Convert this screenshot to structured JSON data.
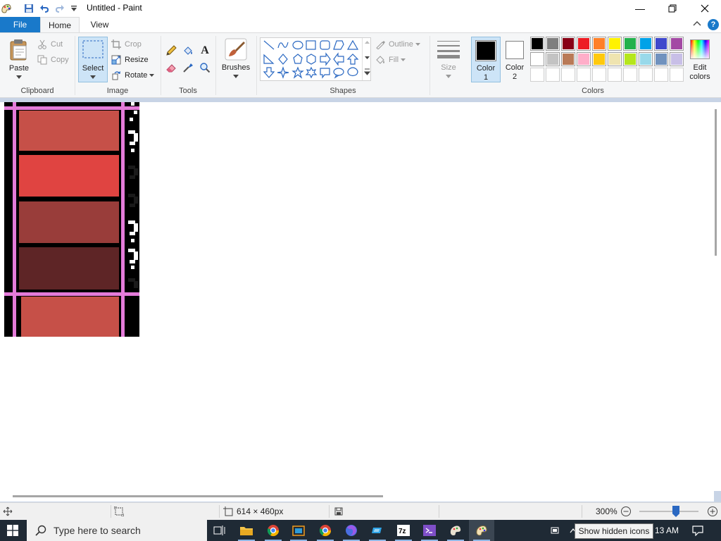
{
  "window": {
    "title": "Untitled - Paint",
    "minimize_glyph": "—",
    "restore_glyph": "❐",
    "close_glyph": "✕"
  },
  "tabs": {
    "file": "File",
    "home": "Home",
    "view": "View"
  },
  "help_glyph": "?",
  "clipboard": {
    "paste": "Paste",
    "cut": "Cut",
    "copy": "Copy",
    "label": "Clipboard"
  },
  "image": {
    "select": "Select",
    "crop": "Crop",
    "resize": "Resize",
    "rotate": "Rotate",
    "label": "Image"
  },
  "tools": {
    "label": "Tools",
    "text_glyph": "A"
  },
  "brushes": {
    "label": "Brushes"
  },
  "shapes": {
    "outline": "Outline",
    "fill": "Fill",
    "label": "Shapes"
  },
  "size": {
    "label": "Size"
  },
  "color1": {
    "label_line1": "Color",
    "label_line2": "1",
    "value": "#000000"
  },
  "color2": {
    "label_line1": "Color",
    "label_line2": "2",
    "value": "#ffffff"
  },
  "colors": {
    "label": "Colors",
    "edit_line1": "Edit",
    "edit_line2": "colors",
    "palette_row1": [
      "#000000",
      "#7f7f7f",
      "#880015",
      "#ed1c24",
      "#ff7f27",
      "#fff200",
      "#22b14c",
      "#00a2e8",
      "#3f48cc",
      "#a349a4"
    ],
    "palette_row2": [
      "#ffffff",
      "#c3c3c3",
      "#b97a57",
      "#ffaec9",
      "#ffc90e",
      "#efe4b0",
      "#b5e61d",
      "#99d9ea",
      "#7092be",
      "#c8bfe7"
    ],
    "palette_row3": [
      "#ffffff",
      "#ffffff",
      "#ffffff",
      "#ffffff",
      "#ffffff",
      "#ffffff",
      "#ffffff",
      "#ffffff",
      "#ffffff",
      "#ffffff"
    ]
  },
  "status": {
    "dimensions": "614 × 460px",
    "zoom": "300%"
  },
  "taskbar": {
    "search_placeholder": "Type here to search",
    "tooltip": "Show hidden icons",
    "clock": "13 AM"
  }
}
